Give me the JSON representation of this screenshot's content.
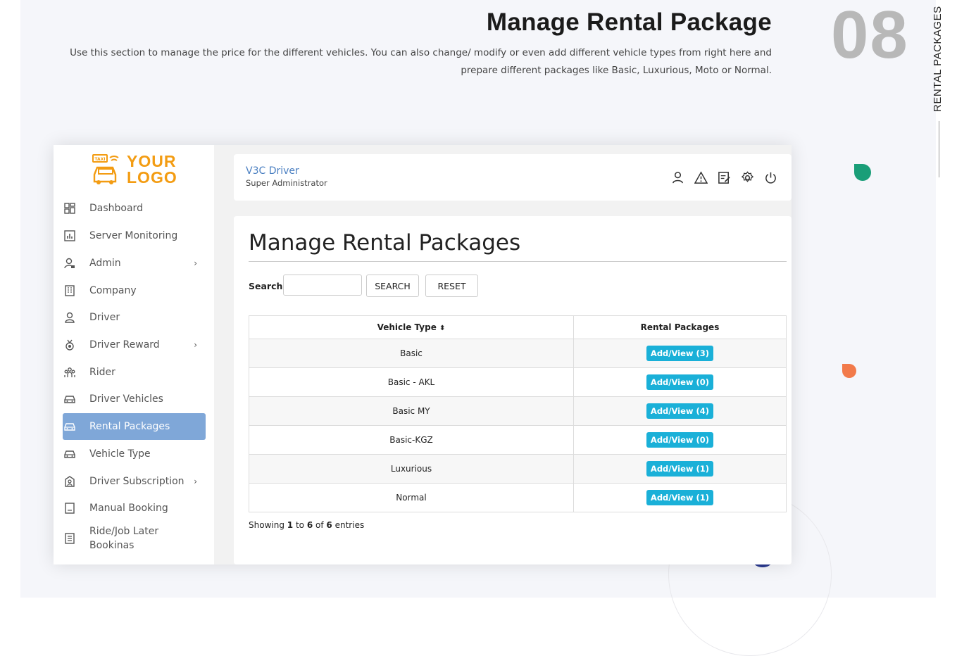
{
  "hero": {
    "title": "Manage Rental Package",
    "description": "Use this section to manage the price for the different vehicles. You can also change/ modify or even add different vehicle types from right here and prepare different packages like Basic, Luxurious, Moto or Normal.",
    "number": "08",
    "side_caption": "RENTAL PACKAGES"
  },
  "logo": {
    "line1": "YOUR",
    "line2": "LOGO",
    "badge": "TAXI"
  },
  "sidebar": {
    "items": [
      {
        "label": "Dashboard",
        "icon": "dashboard-icon",
        "has_submenu": false
      },
      {
        "label": "Server Monitoring",
        "icon": "chart-icon",
        "has_submenu": false
      },
      {
        "label": "Admin",
        "icon": "admin-user-icon",
        "has_submenu": true
      },
      {
        "label": "Company",
        "icon": "building-icon",
        "has_submenu": false
      },
      {
        "label": "Driver",
        "icon": "driver-icon",
        "has_submenu": false
      },
      {
        "label": "Driver Reward",
        "icon": "medal-icon",
        "has_submenu": true
      },
      {
        "label": "Rider",
        "icon": "group-icon",
        "has_submenu": false
      },
      {
        "label": "Driver Vehicles",
        "icon": "car-icon",
        "has_submenu": false
      },
      {
        "label": "Rental Packages",
        "icon": "car-icon",
        "has_submenu": false,
        "active": true
      },
      {
        "label": "Vehicle Type",
        "icon": "car-icon",
        "has_submenu": false
      },
      {
        "label": "Driver Subscription",
        "icon": "subscription-icon",
        "has_submenu": true
      },
      {
        "label": "Manual Booking",
        "icon": "book-icon",
        "has_submenu": false
      },
      {
        "label": "Ride/Job Later Bookinas",
        "icon": "list-icon",
        "has_submenu": false
      }
    ],
    "chevron": "›"
  },
  "topbar": {
    "title": "V3C Driver",
    "subtitle": "Super Administrator",
    "icons": [
      "user-icon",
      "warning-icon",
      "edit-icon",
      "settings-icon",
      "power-icon"
    ]
  },
  "panel": {
    "title": "Manage Rental Packages",
    "search_label": "Search:",
    "search_value": "",
    "search_button": "SEARCH",
    "reset_button": "RESET",
    "columns": [
      "Vehicle Type",
      "Rental Packages"
    ],
    "sort_glyph": "⬍",
    "rows": [
      {
        "vehicle_type": "Basic",
        "action": "Add/View (3)"
      },
      {
        "vehicle_type": "Basic - AKL",
        "action": "Add/View (0)"
      },
      {
        "vehicle_type": "Basic MY",
        "action": "Add/View (4)"
      },
      {
        "vehicle_type": "Basic-KGZ",
        "action": "Add/View (0)"
      },
      {
        "vehicle_type": "Luxurious",
        "action": "Add/View (1)"
      },
      {
        "vehicle_type": "Normal",
        "action": "Add/View (1)"
      }
    ],
    "showing": {
      "prefix": "Showing",
      "from": "1",
      "to_word": "to",
      "to": "6",
      "of_word": "of",
      "total": "6",
      "suffix": "entries"
    }
  },
  "colors": {
    "accent": "#7fa7d8",
    "button": "#1ab0d8",
    "logo": "#f39c12",
    "title_link": "#4a7fc1"
  }
}
